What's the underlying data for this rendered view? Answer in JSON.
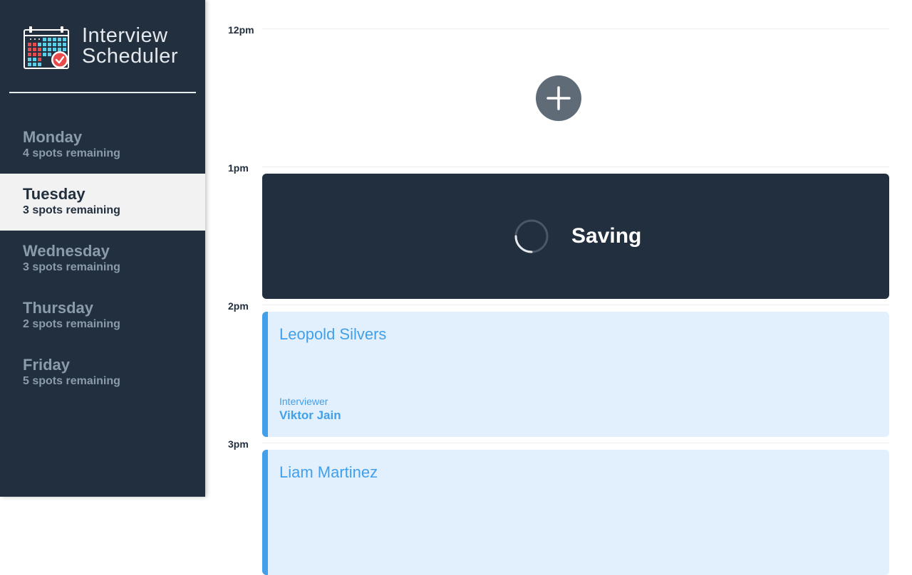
{
  "app": {
    "title_line1": "Interview",
    "title_line2": "Scheduler"
  },
  "sidebar": {
    "days": [
      {
        "name": "Monday",
        "spots": "4 spots remaining",
        "selected": false
      },
      {
        "name": "Tuesday",
        "spots": "3 spots remaining",
        "selected": true
      },
      {
        "name": "Wednesday",
        "spots": "3 spots remaining",
        "selected": false
      },
      {
        "name": "Thursday",
        "spots": "2 spots remaining",
        "selected": false
      },
      {
        "name": "Friday",
        "spots": "5 spots remaining",
        "selected": false
      }
    ]
  },
  "schedule": {
    "times": [
      "12pm",
      "1pm",
      "2pm",
      "3pm"
    ],
    "add_icon": "plus-icon",
    "saving": {
      "text": "Saving",
      "icon": "spinner-icon"
    },
    "appointments": [
      {
        "student": "Leopold Silvers",
        "interviewer_label": "Interviewer",
        "interviewer": "Viktor Jain"
      },
      {
        "student": "Liam Martinez"
      }
    ]
  },
  "colors": {
    "sidebar_bg": "#222f3e",
    "selected_bg": "#f2f2f2",
    "muted_text": "#8a9bab",
    "accent_blue": "#42a0ea",
    "appointment_bg": "#e2effc",
    "add_button": "#5f6b77"
  }
}
